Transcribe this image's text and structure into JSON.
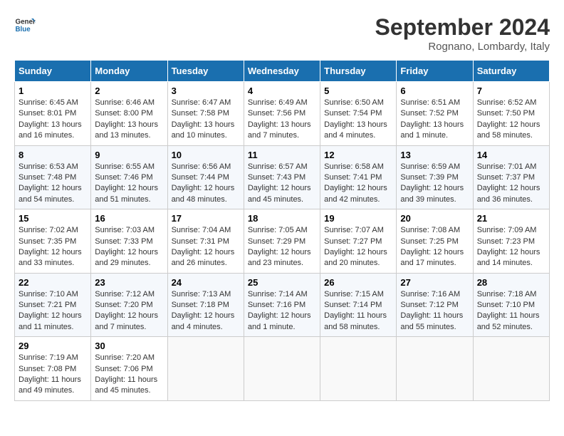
{
  "header": {
    "logo_line1": "General",
    "logo_line2": "Blue",
    "month_title": "September 2024",
    "location": "Rognano, Lombardy, Italy"
  },
  "weekdays": [
    "Sunday",
    "Monday",
    "Tuesday",
    "Wednesday",
    "Thursday",
    "Friday",
    "Saturday"
  ],
  "weeks": [
    [
      {
        "day": "1",
        "sunrise": "6:45 AM",
        "sunset": "8:01 PM",
        "daylight": "13 hours and 16 minutes."
      },
      {
        "day": "2",
        "sunrise": "6:46 AM",
        "sunset": "8:00 PM",
        "daylight": "13 hours and 13 minutes."
      },
      {
        "day": "3",
        "sunrise": "6:47 AM",
        "sunset": "7:58 PM",
        "daylight": "13 hours and 10 minutes."
      },
      {
        "day": "4",
        "sunrise": "6:49 AM",
        "sunset": "7:56 PM",
        "daylight": "13 hours and 7 minutes."
      },
      {
        "day": "5",
        "sunrise": "6:50 AM",
        "sunset": "7:54 PM",
        "daylight": "13 hours and 4 minutes."
      },
      {
        "day": "6",
        "sunrise": "6:51 AM",
        "sunset": "7:52 PM",
        "daylight": "13 hours and 1 minute."
      },
      {
        "day": "7",
        "sunrise": "6:52 AM",
        "sunset": "7:50 PM",
        "daylight": "12 hours and 58 minutes."
      }
    ],
    [
      {
        "day": "8",
        "sunrise": "6:53 AM",
        "sunset": "7:48 PM",
        "daylight": "12 hours and 54 minutes."
      },
      {
        "day": "9",
        "sunrise": "6:55 AM",
        "sunset": "7:46 PM",
        "daylight": "12 hours and 51 minutes."
      },
      {
        "day": "10",
        "sunrise": "6:56 AM",
        "sunset": "7:44 PM",
        "daylight": "12 hours and 48 minutes."
      },
      {
        "day": "11",
        "sunrise": "6:57 AM",
        "sunset": "7:43 PM",
        "daylight": "12 hours and 45 minutes."
      },
      {
        "day": "12",
        "sunrise": "6:58 AM",
        "sunset": "7:41 PM",
        "daylight": "12 hours and 42 minutes."
      },
      {
        "day": "13",
        "sunrise": "6:59 AM",
        "sunset": "7:39 PM",
        "daylight": "12 hours and 39 minutes."
      },
      {
        "day": "14",
        "sunrise": "7:01 AM",
        "sunset": "7:37 PM",
        "daylight": "12 hours and 36 minutes."
      }
    ],
    [
      {
        "day": "15",
        "sunrise": "7:02 AM",
        "sunset": "7:35 PM",
        "daylight": "12 hours and 33 minutes."
      },
      {
        "day": "16",
        "sunrise": "7:03 AM",
        "sunset": "7:33 PM",
        "daylight": "12 hours and 29 minutes."
      },
      {
        "day": "17",
        "sunrise": "7:04 AM",
        "sunset": "7:31 PM",
        "daylight": "12 hours and 26 minutes."
      },
      {
        "day": "18",
        "sunrise": "7:05 AM",
        "sunset": "7:29 PM",
        "daylight": "12 hours and 23 minutes."
      },
      {
        "day": "19",
        "sunrise": "7:07 AM",
        "sunset": "7:27 PM",
        "daylight": "12 hours and 20 minutes."
      },
      {
        "day": "20",
        "sunrise": "7:08 AM",
        "sunset": "7:25 PM",
        "daylight": "12 hours and 17 minutes."
      },
      {
        "day": "21",
        "sunrise": "7:09 AM",
        "sunset": "7:23 PM",
        "daylight": "12 hours and 14 minutes."
      }
    ],
    [
      {
        "day": "22",
        "sunrise": "7:10 AM",
        "sunset": "7:21 PM",
        "daylight": "12 hours and 11 minutes."
      },
      {
        "day": "23",
        "sunrise": "7:12 AM",
        "sunset": "7:20 PM",
        "daylight": "12 hours and 7 minutes."
      },
      {
        "day": "24",
        "sunrise": "7:13 AM",
        "sunset": "7:18 PM",
        "daylight": "12 hours and 4 minutes."
      },
      {
        "day": "25",
        "sunrise": "7:14 AM",
        "sunset": "7:16 PM",
        "daylight": "12 hours and 1 minute."
      },
      {
        "day": "26",
        "sunrise": "7:15 AM",
        "sunset": "7:14 PM",
        "daylight": "11 hours and 58 minutes."
      },
      {
        "day": "27",
        "sunrise": "7:16 AM",
        "sunset": "7:12 PM",
        "daylight": "11 hours and 55 minutes."
      },
      {
        "day": "28",
        "sunrise": "7:18 AM",
        "sunset": "7:10 PM",
        "daylight": "11 hours and 52 minutes."
      }
    ],
    [
      {
        "day": "29",
        "sunrise": "7:19 AM",
        "sunset": "7:08 PM",
        "daylight": "11 hours and 49 minutes."
      },
      {
        "day": "30",
        "sunrise": "7:20 AM",
        "sunset": "7:06 PM",
        "daylight": "11 hours and 45 minutes."
      },
      null,
      null,
      null,
      null,
      null
    ]
  ]
}
